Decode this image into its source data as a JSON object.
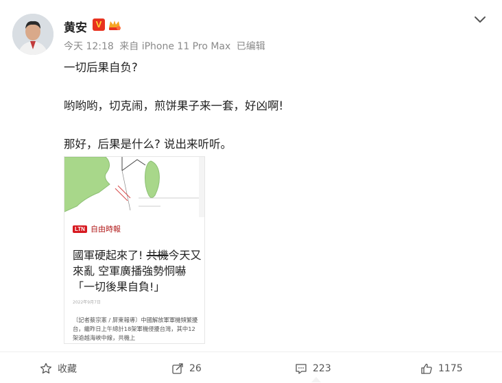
{
  "author": {
    "name": "黄安",
    "verified_badge": "V",
    "meta": {
      "time": "今天 12:18",
      "source": "来自 iPhone 11 Pro Max",
      "edited": "已编辑"
    }
  },
  "post": {
    "lines": [
      "一切后果自负?",
      "哟哟哟，切克闹，煎饼果子来一套，好凶啊!",
      "那好，后果是什么? 说出来听听。"
    ]
  },
  "card": {
    "logo_ltn": "LTN",
    "logo_paper": "自由時報",
    "headline_pre": "國軍硬起來了! ",
    "headline_strike": "共機",
    "headline_post": "今天又來亂 空軍廣播強勢恫嚇「一切後果自負!」",
    "date": "2022年9月7日",
    "body": "〔記者蔡宗憲 / 屏東報導〕中國解放軍軍機頻繁擾台，繼昨日上午總計18架軍機侵擾台灣，其中12架逾越海峽中線，共機上"
  },
  "actions": {
    "favorite": "收藏",
    "repost": "26",
    "comment": "223",
    "like": "1175"
  },
  "colors": {
    "accent": "#e8321f",
    "meta_gray": "#8a8a8a"
  }
}
